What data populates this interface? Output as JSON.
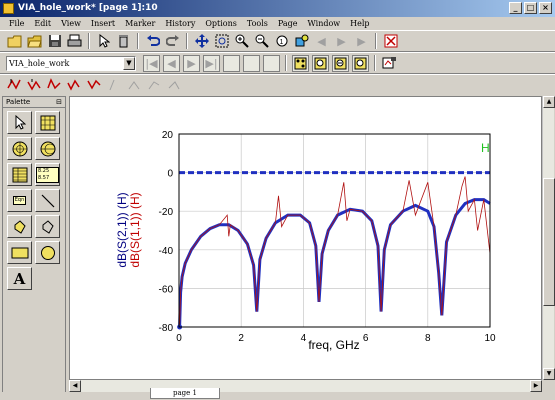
{
  "window": {
    "title": "VIA_hole_work* [page 1]:10",
    "buttons": [
      "_",
      "□",
      "×"
    ]
  },
  "menubar": [
    "File",
    "Edit",
    "View",
    "Insert",
    "Marker",
    "History",
    "Options",
    "Tools",
    "Page",
    "Window",
    "Help"
  ],
  "toolbar2": {
    "combo_value": "VIA_hole_work"
  },
  "palette": {
    "title": "Palette",
    "tools": [
      "pointer",
      "rectangular-plot",
      "polar-plot",
      "smith-chart",
      "list",
      "stacked-list",
      "equation",
      "line",
      "polyline",
      "polygon",
      "rectangle",
      "ellipse",
      "text"
    ],
    "equation_label": "Eqn",
    "stacked_label": "8.25 8.57",
    "text_label": "A"
  },
  "page_tab": "page 1",
  "colors": {
    "blue_trace": "#2030c0",
    "red_trace": "#b01010",
    "marker_green": "#20c020",
    "axis_label_blue": "#000080",
    "axis_label_red": "#c00000"
  },
  "chart_data": {
    "type": "line",
    "xlabel": "freq, GHz",
    "ylabel_lines": [
      "dB(S(2,1)) (H)",
      "dB(S(1,1)) (H)"
    ],
    "xlim": [
      0,
      10
    ],
    "ylim": [
      -80,
      20
    ],
    "x_ticks": [
      0,
      2,
      4,
      6,
      8,
      10
    ],
    "y_ticks": [
      20,
      0,
      -20,
      -40,
      -60,
      -80
    ],
    "marker_label": "H",
    "series": [
      {
        "name": "dB(S(2,1)) (H)",
        "style": "dashed",
        "x": [
          0,
          1,
          2,
          3,
          4,
          5,
          6,
          7,
          8,
          9,
          10
        ],
        "y": [
          0,
          0,
          0,
          0,
          0,
          0,
          0,
          0,
          0,
          0,
          0
        ]
      },
      {
        "name": "dB(S(1,1)) (H)",
        "style": "thick",
        "x": [
          0.02,
          0.05,
          0.1,
          0.2,
          0.4,
          0.7,
          1.0,
          1.3,
          1.6,
          1.9,
          2.2,
          2.4,
          2.5,
          2.6,
          2.8,
          3.1,
          3.5,
          3.9,
          4.2,
          4.4,
          4.5,
          4.6,
          4.8,
          5.1,
          5.5,
          5.9,
          6.2,
          6.4,
          6.5,
          6.6,
          6.8,
          7.2,
          7.6,
          8.0,
          8.2,
          8.35,
          8.45,
          8.6,
          8.9,
          9.2,
          9.5,
          9.8,
          10.0
        ],
        "y": [
          -80,
          -62,
          -54,
          -47,
          -40,
          -33,
          -29,
          -27,
          -27,
          -30,
          -37,
          -48,
          -72,
          -45,
          -34,
          -26,
          -22,
          -22,
          -26,
          -38,
          -67,
          -42,
          -30,
          -22,
          -19,
          -20,
          -25,
          -38,
          -72,
          -40,
          -27,
          -20,
          -17,
          -20,
          -28,
          -52,
          -74,
          -36,
          -22,
          -16,
          -14,
          -14,
          -16
        ]
      },
      {
        "name": "dB(S(1,1)) (H) detail",
        "style": "thin",
        "x": [
          0.02,
          0.05,
          0.1,
          0.2,
          0.4,
          0.7,
          1.0,
          1.3,
          1.55,
          1.6,
          1.65,
          1.9,
          2.2,
          2.4,
          2.5,
          2.6,
          2.8,
          3.1,
          3.2,
          3.3,
          3.5,
          3.9,
          4.2,
          4.4,
          4.5,
          4.6,
          4.8,
          5.1,
          5.3,
          5.4,
          5.5,
          5.9,
          6.2,
          6.4,
          6.5,
          6.6,
          6.8,
          7.2,
          7.4,
          7.6,
          8.0,
          8.2,
          8.35,
          8.45,
          8.6,
          8.9,
          9.1,
          9.2,
          9.3,
          9.5,
          9.6,
          9.8,
          10.0
        ],
        "y": [
          -80,
          -62,
          -54,
          -47,
          -40,
          -33,
          -29,
          -27,
          -22,
          -33,
          -27,
          -30,
          -37,
          -48,
          -72,
          -45,
          -34,
          -26,
          -12,
          -28,
          -22,
          -22,
          -26,
          -38,
          -67,
          -42,
          -30,
          -22,
          -5,
          -25,
          -19,
          -20,
          -25,
          -38,
          -72,
          -40,
          -27,
          -20,
          -4,
          -22,
          -5,
          -28,
          -52,
          -74,
          -36,
          -22,
          -7,
          -2,
          -20,
          -14,
          -30,
          -14,
          -42
        ]
      }
    ]
  }
}
